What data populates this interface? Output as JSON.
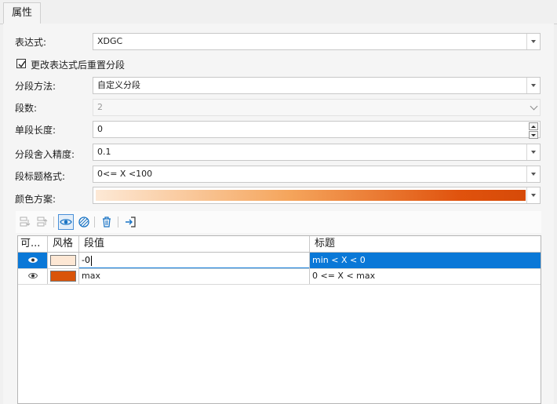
{
  "tab": {
    "label": "属性"
  },
  "form": {
    "expression": {
      "label": "表达式:",
      "value": "XDGC"
    },
    "reset_checkbox": {
      "label": "更改表达式后重置分段",
      "checked": true
    },
    "method": {
      "label": "分段方法:",
      "value": "自定义分段"
    },
    "count": {
      "label": "段数:",
      "value": "2"
    },
    "length": {
      "label": "单段长度:",
      "value": "0"
    },
    "precision": {
      "label": "分段舍入精度:",
      "value": "0.1"
    },
    "title_format": {
      "label": "段标题格式:",
      "value": "0<= X <100"
    },
    "color_scheme": {
      "label": "颜色方案:"
    }
  },
  "toolbar": {
    "icons": [
      "merge-segment-icon",
      "split-segment-icon",
      "visibility-icon",
      "style-icon",
      "delete-icon",
      "import-icon"
    ]
  },
  "table": {
    "headers": [
      "可...",
      "风格",
      "段值",
      "标题"
    ],
    "rows": [
      {
        "visible": true,
        "color": "#fde7d4",
        "value": "-0",
        "title": "min < X < 0",
        "selected": true
      },
      {
        "visible": true,
        "color": "#d9540a",
        "value": "max",
        "title": "0 <= X < max",
        "selected": false
      }
    ]
  }
}
